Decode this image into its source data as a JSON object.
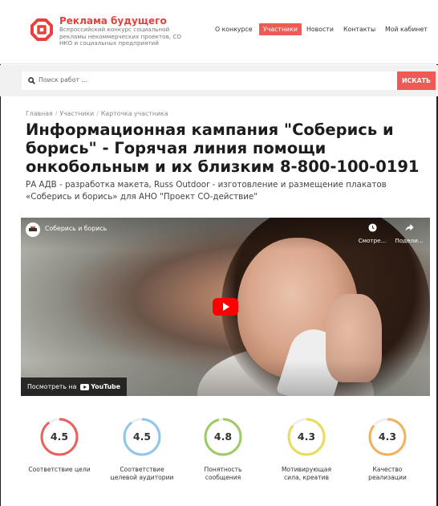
{
  "header": {
    "brand_title": "Реклама будущего",
    "brand_sub": "Всероссийский конкурс социальной рекламы некоммерческих проектов, СО НКО и социальных предприятий",
    "nav": [
      {
        "label": "О конкурсе",
        "active": false
      },
      {
        "label": "Участники",
        "active": true
      },
      {
        "label": "Новости",
        "active": false
      },
      {
        "label": "Контакты",
        "active": false
      },
      {
        "label": "Мой кабинет",
        "active": false
      }
    ],
    "accent_color": "#f05a55"
  },
  "search": {
    "placeholder": "Поиск работ ...",
    "button_label": "ИСКАТЬ"
  },
  "breadcrumb": [
    "Главная",
    "Участники",
    "Карточка участника"
  ],
  "page": {
    "title": "Информационная кампания \"Соберись и борись\" - Горячая линия помощи онкобольным и их близким 8-800-100-0191",
    "subtitle": "РА АДВ - разработка макета, Russ Outdoor - изготовление и размещение плакатов «Соберись и борись» для АНО \"Проект СО-действие\""
  },
  "video": {
    "title": "Соберись и борись",
    "watch_later_label": "Смотре...",
    "share_label": "Подели...",
    "watch_on_label": "Посмотреть на",
    "youtube_label": "YouTube"
  },
  "ratings": [
    {
      "value": "4.5",
      "score": 4.5,
      "label": "Соответствие цели",
      "color": "#e8615c"
    },
    {
      "value": "4.5",
      "score": 4.5,
      "label": "Соответствие целевой аудитории",
      "color": "#8fc6ea"
    },
    {
      "value": "4.8",
      "score": 4.8,
      "label": "Понятность сообщения",
      "color": "#9ccc65"
    },
    {
      "value": "4.3",
      "score": 4.3,
      "label": "Мотивирующая сила, креатив",
      "color": "#e8dc5a"
    },
    {
      "value": "4.3",
      "score": 4.3,
      "label": "Качество реализации",
      "color": "#f0b35c"
    }
  ]
}
